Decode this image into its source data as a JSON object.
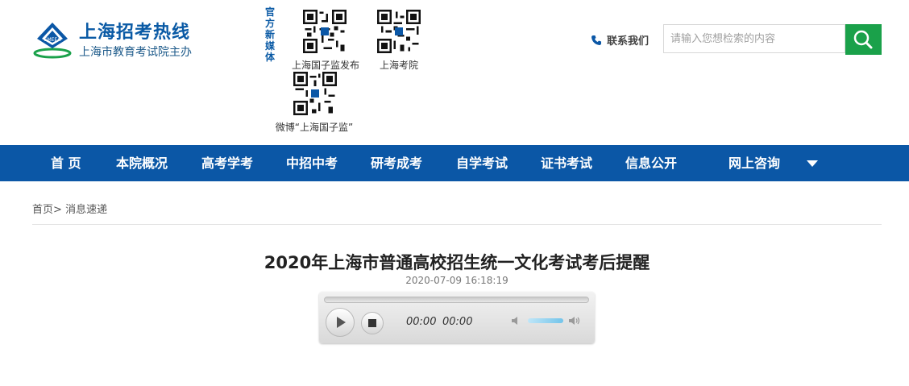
{
  "logo": {
    "title": "上海招考热线",
    "subtitle": "上海市教育考试院主办",
    "badge": "SMEEA"
  },
  "media": {
    "label": "官方新媒体",
    "qrcodes": [
      {
        "caption": "上海国子监发布"
      },
      {
        "caption": "上海考院"
      },
      {
        "caption": "微博“上海国子监”"
      }
    ]
  },
  "header": {
    "contact_label": "联系我们",
    "search_placeholder": "请输入您想检索的内容",
    "brand_color": "#0b57a6",
    "search_color": "#1aa14a"
  },
  "nav": {
    "items": [
      {
        "label": "首 页"
      },
      {
        "label": "本院概况"
      },
      {
        "label": "高考学考"
      },
      {
        "label": "中招中考"
      },
      {
        "label": "研考成考"
      },
      {
        "label": "自学考试"
      },
      {
        "label": "证书考试"
      },
      {
        "label": "信息公开"
      },
      {
        "label": "网上咨询"
      }
    ]
  },
  "breadcrumb": {
    "home": "首页",
    "separator": ">",
    "current": "消息速递"
  },
  "article": {
    "title": "2020年上海市普通高校招生统一文化考试考后提醒",
    "date": "2020-07-09 16:18:19"
  },
  "player": {
    "current_time": "00:00",
    "duration": "00:00"
  }
}
